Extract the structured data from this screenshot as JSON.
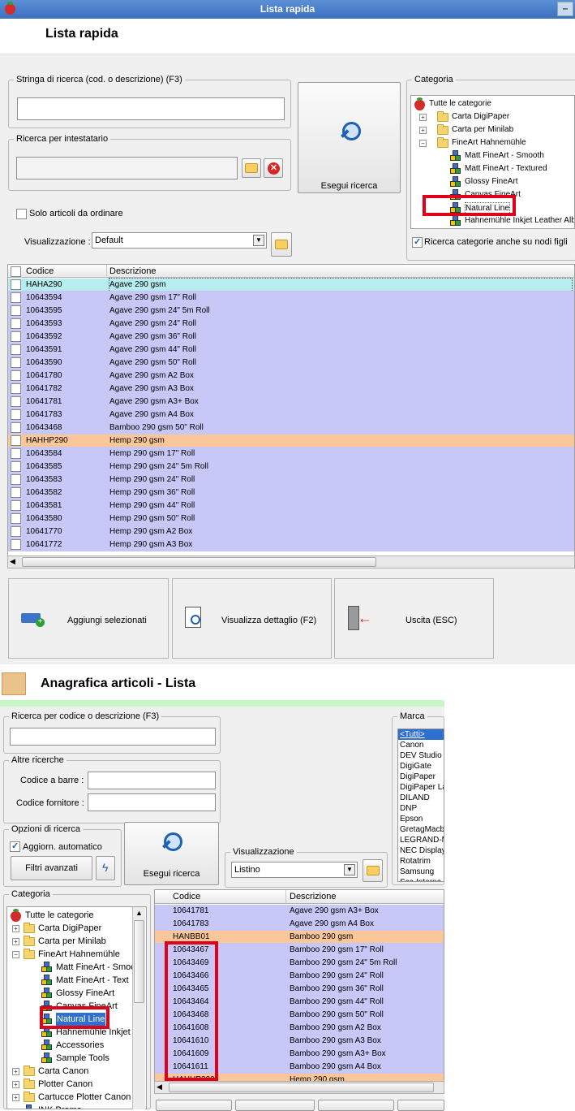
{
  "win1": {
    "title": "Lista rapida",
    "header": "Lista rapida",
    "search_legend": "Stringa di ricerca (cod. o descrizione) (F3)",
    "search_value": "",
    "holder_legend": "Ricerca per intestatario",
    "run_search": "Esegui ricerca",
    "only_to_order": "Solo articoli da ordinare",
    "view_label": "Visualizzazione :",
    "view_value": "Default",
    "cat_legend": "Categoria",
    "tree": [
      {
        "label": "Tutte le categorie",
        "icon": "berry"
      },
      {
        "label": "Carta DigiPaper",
        "icon": "folder"
      },
      {
        "label": "Carta per Minilab",
        "icon": "folder"
      },
      {
        "label": "FineArt Hahnemühle",
        "icon": "folder"
      },
      {
        "label": "Matt FineArt - Smooth",
        "icon": "cubes"
      },
      {
        "label": "Matt FineArt - Textured",
        "icon": "cubes"
      },
      {
        "label": "Glossy FineArt",
        "icon": "cubes"
      },
      {
        "label": "Canvas FineArt",
        "icon": "cubes"
      },
      {
        "label": "Natural Line",
        "icon": "cubes"
      },
      {
        "label": "Hahnemühle Inkjet Leather Alb",
        "icon": "cubes"
      }
    ],
    "subnodes": "Ricerca categorie anche su nodi figli",
    "col_code": "Codice",
    "col_desc": "Descrizione",
    "rows": [
      {
        "code": "HAHA290",
        "desc": "Agave 290 gsm",
        "kind": "first"
      },
      {
        "code": "10643594",
        "desc": "Agave 290 gsm 17\" Roll",
        "kind": "item"
      },
      {
        "code": "10643595",
        "desc": "Agave 290 gsm 24\" 5m Roll",
        "kind": "item"
      },
      {
        "code": "10643593",
        "desc": "Agave 290 gsm 24\" Roll",
        "kind": "item"
      },
      {
        "code": "10643592",
        "desc": "Agave 290 gsm 36\" Roll",
        "kind": "item"
      },
      {
        "code": "10643591",
        "desc": "Agave 290 gsm 44\" Roll",
        "kind": "item"
      },
      {
        "code": "10643590",
        "desc": "Agave 290 gsm 50\" Roll",
        "kind": "item"
      },
      {
        "code": "10641780",
        "desc": "Agave 290 gsm A2 Box",
        "kind": "item"
      },
      {
        "code": "10641782",
        "desc": "Agave 290 gsm A3 Box",
        "kind": "item"
      },
      {
        "code": "10641781",
        "desc": "Agave 290 gsm A3+ Box",
        "kind": "item"
      },
      {
        "code": "10641783",
        "desc": "Agave 290 gsm A4 Box",
        "kind": "item"
      },
      {
        "code": "10643468",
        "desc": "Bamboo 290 gsm 50\" Roll",
        "kind": "item"
      },
      {
        "code": "HAHHP290",
        "desc": "Hemp 290 gsm",
        "kind": "parent"
      },
      {
        "code": "10643584",
        "desc": "Hemp 290 gsm 17\" Roll",
        "kind": "item"
      },
      {
        "code": "10643585",
        "desc": "Hemp 290 gsm 24\" 5m Roll",
        "kind": "item"
      },
      {
        "code": "10643583",
        "desc": "Hemp 290 gsm 24\" Roll",
        "kind": "item"
      },
      {
        "code": "10643582",
        "desc": "Hemp 290 gsm 36\" Roll",
        "kind": "item"
      },
      {
        "code": "10643581",
        "desc": "Hemp 290 gsm 44\" Roll",
        "kind": "item"
      },
      {
        "code": "10643580",
        "desc": "Hemp 290 gsm 50\" Roll",
        "kind": "item"
      },
      {
        "code": "10641770",
        "desc": "Hemp 290 gsm A2 Box",
        "kind": "item"
      },
      {
        "code": "10641772",
        "desc": "Hemp 290 gsm A3 Box",
        "kind": "item"
      }
    ],
    "btn_add": "Aggiungi selezionati",
    "btn_detail": "Visualizza dettaglio (F2)",
    "btn_exit": "Uscita (ESC)"
  },
  "win2": {
    "header": "Anagrafica articoli  - Lista",
    "search_legend": "Ricerca per codice o descrizione (F3)",
    "other_legend": "Altre ricerche",
    "barcode_label": "Codice a barre :",
    "supplier_label": "Codice fornitore :",
    "options_legend": "Opzioni di ricerca",
    "auto_update": "Aggiorn. automatico",
    "advanced_filters": "Filtri avanzati",
    "run_search": "Esegui ricerca",
    "view_legend": "Visualizzazione",
    "view_value": "Listino",
    "brand_legend": "Marca",
    "brands": [
      "<Tutti>",
      "Canon",
      "DEV Studio",
      "DigiGate",
      "DigiPaper",
      "DigiPaper La",
      "DILAND",
      "DNP",
      "Epson",
      "GretagMacb",
      "LEGRAND-M",
      "NEC Display",
      "Rotatrim",
      "Samsung",
      "Sca Interna"
    ],
    "cat_legend": "Categoria",
    "tree": [
      {
        "label": "Tutte le categorie",
        "icon": "berry",
        "pm": ""
      },
      {
        "label": "Carta DigiPaper",
        "icon": "folder",
        "pm": "+"
      },
      {
        "label": "Carta per Minilab",
        "icon": "folder",
        "pm": "+"
      },
      {
        "label": "FineArt Hahnemühle",
        "icon": "folder",
        "pm": "−"
      },
      {
        "label": "Matt FineArt - Smoo",
        "icon": "cubes",
        "pm": ""
      },
      {
        "label": "Matt FineArt - Text",
        "icon": "cubes",
        "pm": ""
      },
      {
        "label": "Glossy FineArt",
        "icon": "cubes",
        "pm": ""
      },
      {
        "label": "Canvas FineArt",
        "icon": "cubes",
        "pm": ""
      },
      {
        "label": "Natural Line",
        "icon": "cubes",
        "pm": ""
      },
      {
        "label": "Hahnemühle Inkjet",
        "icon": "cubes",
        "pm": ""
      },
      {
        "label": "Accessories",
        "icon": "cubes",
        "pm": ""
      },
      {
        "label": "Sample Tools",
        "icon": "cubes",
        "pm": ""
      },
      {
        "label": "Carta Canon",
        "icon": "folder",
        "pm": "+"
      },
      {
        "label": "Plotter Canon",
        "icon": "folder",
        "pm": "+"
      },
      {
        "label": "Cartucce Plotter Canon",
        "icon": "folder",
        "pm": "+"
      },
      {
        "label": "INK Promo",
        "icon": "cubes",
        "pm": ""
      }
    ],
    "col_code": "Codice",
    "col_desc": "Descrizione",
    "rows": [
      {
        "code": "10641781",
        "desc": "Agave 290 gsm A3+ Box",
        "kind": "item"
      },
      {
        "code": "10641783",
        "desc": "Agave 290 gsm A4 Box",
        "kind": "item"
      },
      {
        "code": "HANBB01",
        "desc": "Bamboo 290 gsm",
        "kind": "parent"
      },
      {
        "code": "10643467",
        "desc": "Bamboo 290 gsm 17\" Roll",
        "kind": "item"
      },
      {
        "code": "10643469",
        "desc": "Bamboo 290 gsm 24\" 5m Roll",
        "kind": "item"
      },
      {
        "code": "10643466",
        "desc": "Bamboo 290 gsm 24\" Roll",
        "kind": "item"
      },
      {
        "code": "10643465",
        "desc": "Bamboo 290 gsm 36\" Roll",
        "kind": "item"
      },
      {
        "code": "10643464",
        "desc": "Bamboo 290 gsm 44\" Roll",
        "kind": "item"
      },
      {
        "code": "10643468",
        "desc": "Bamboo 290 gsm 50\" Roll",
        "kind": "item"
      },
      {
        "code": "10641608",
        "desc": "Bamboo 290 gsm A2 Box",
        "kind": "item"
      },
      {
        "code": "10641610",
        "desc": "Bamboo 290 gsm A3  Box",
        "kind": "item"
      },
      {
        "code": "10641609",
        "desc": "Bamboo 290 gsm A3+ Box",
        "kind": "item"
      },
      {
        "code": "10641611",
        "desc": "Bamboo 290 gsm A4 Box",
        "kind": "item"
      },
      {
        "code": "HAHHP290",
        "desc": "Hemp 290 gsm",
        "kind": "parent"
      }
    ]
  },
  "colors": {
    "row_item": "#c7c8f7",
    "row_parent": "#fbc79a",
    "row_first": "#b7ecf0",
    "highlight": "#e0001a"
  }
}
